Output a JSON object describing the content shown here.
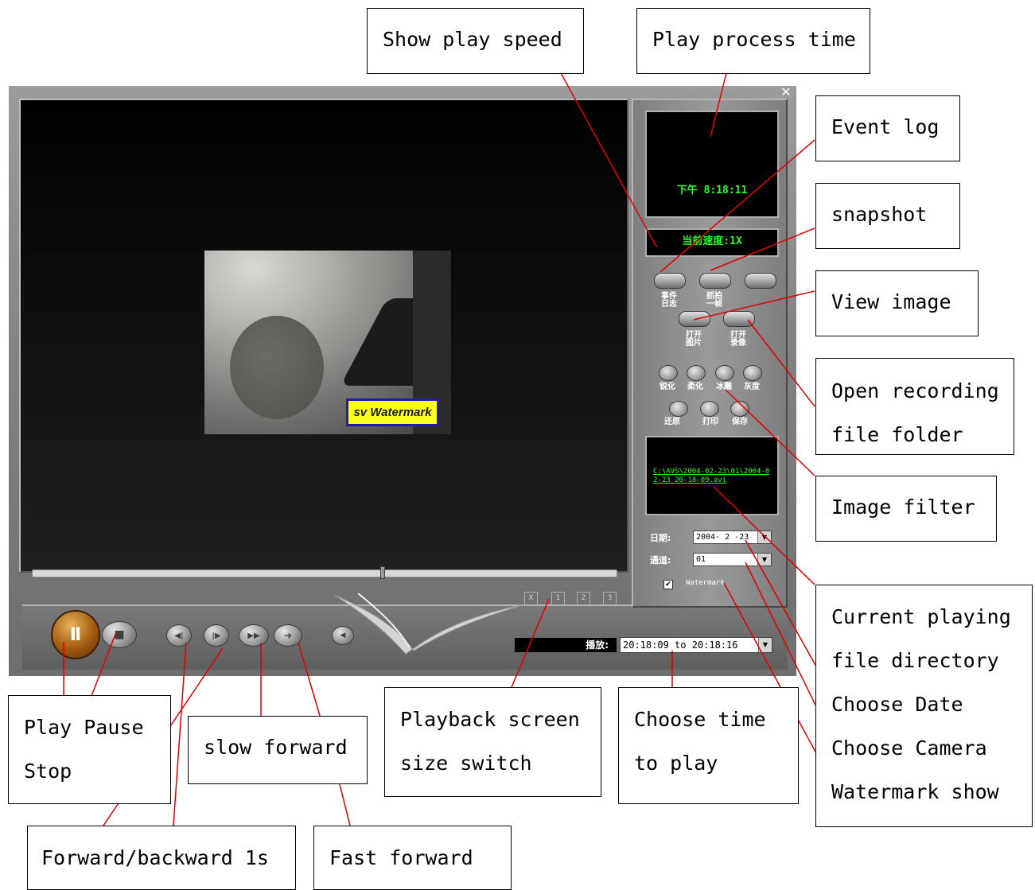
{
  "player": {
    "close_icon": "close-icon",
    "watermark_text": "sv Watermark",
    "time_display": "下午 8:18:11",
    "speed_display": "当前速度:1X",
    "side_buttons": [
      {
        "label": "事件\n日志"
      },
      {
        "label": "抓拍\n一帧"
      },
      {
        "label": ""
      }
    ],
    "open_buttons": [
      {
        "label": "打开\n图片"
      },
      {
        "label": "打开\n录像"
      }
    ],
    "filter_buttons": [
      {
        "label": "锐化"
      },
      {
        "label": "柔化"
      },
      {
        "label": "冰雕"
      },
      {
        "label": "灰度"
      }
    ],
    "action_buttons": [
      {
        "label": "还原"
      },
      {
        "label": "打印"
      },
      {
        "label": "保存"
      }
    ],
    "file_path": "C:\\AVS\\2004-02-23\\01\\2004-02-23 20-18-09.avi",
    "date_label": "日期:",
    "date_value": "2004- 2 -23",
    "channel_label": "通道:",
    "channel_value": "01",
    "watermark_checkbox_label": "Watermark",
    "watermark_checked": "✔",
    "screen_size_buttons": [
      "X",
      "1",
      "2",
      "3"
    ],
    "play_label": "播放:",
    "time_range": "20:18:09 to 20:18:16",
    "dropdown_arrow": "▼",
    "pause_icon": "Ⅱ",
    "stop_icon": "■",
    "back_1s_icon": "◀|",
    "fwd_1s_icon": "|▶",
    "slow_fwd_icon": "▶▶",
    "fast_fwd_icon": "➔",
    "extra_icon": "◀"
  },
  "callouts": [
    {
      "id": "show-play-speed",
      "text": "Show play speed"
    },
    {
      "id": "play-process-time",
      "text": "Play process time"
    },
    {
      "id": "event-log",
      "text": "Event log"
    },
    {
      "id": "snapshot",
      "text": "snapshot"
    },
    {
      "id": "view-image",
      "text": "View image"
    },
    {
      "id": "open-recording",
      "text": "Open recording\nfile folder"
    },
    {
      "id": "image-filter",
      "text": "Image filter"
    },
    {
      "id": "right-stack",
      "text": "Current playing\nfile directory\nChoose Date\nChoose Camera\nWatermark show"
    },
    {
      "id": "play-pause-stop",
      "text": "Play Pause\nStop"
    },
    {
      "id": "slow-forward",
      "text": "slow forward"
    },
    {
      "id": "screen-size-switch",
      "text": "Playback screen\nsize switch"
    },
    {
      "id": "choose-time",
      "text": "Choose time\nto play"
    },
    {
      "id": "forward-backward-1s",
      "text": "Forward/backward 1s"
    },
    {
      "id": "fast-forward",
      "text": "Fast forward"
    }
  ],
  "colors": {
    "lcd_text": "#22ff22",
    "leader_line": "#e00000",
    "watermark_bg": "#ffff22",
    "watermark_border": "#1d1dab"
  }
}
